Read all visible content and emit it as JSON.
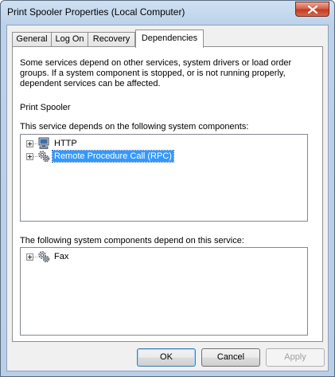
{
  "window": {
    "title": "Print Spooler Properties (Local Computer)"
  },
  "tabs": [
    {
      "label": "General",
      "active": false
    },
    {
      "label": "Log On",
      "active": false
    },
    {
      "label": "Recovery",
      "active": false
    },
    {
      "label": "Dependencies",
      "active": true
    }
  ],
  "dependencies": {
    "description": "Some services depend on other services, system drivers or load order groups. If a system component is stopped, or is not running properly, dependent services can be affected.",
    "service_name": "Print Spooler",
    "depends_on_label": "This service depends on the following system components:",
    "depends_on_items": [
      {
        "label": "HTTP",
        "icon": "computer-icon",
        "selected": false
      },
      {
        "label": "Remote Procedure Call (RPC)",
        "icon": "service-gear-icon",
        "selected": true
      }
    ],
    "dependents_label": "The following system components depend on this service:",
    "dependents_items": [
      {
        "label": "Fax",
        "icon": "service-gear-icon",
        "selected": false
      }
    ]
  },
  "buttons": {
    "ok": "OK",
    "cancel": "Cancel",
    "apply": "Apply"
  },
  "colors": {
    "selection": "#3399ff",
    "close_button": "#c23b21"
  }
}
